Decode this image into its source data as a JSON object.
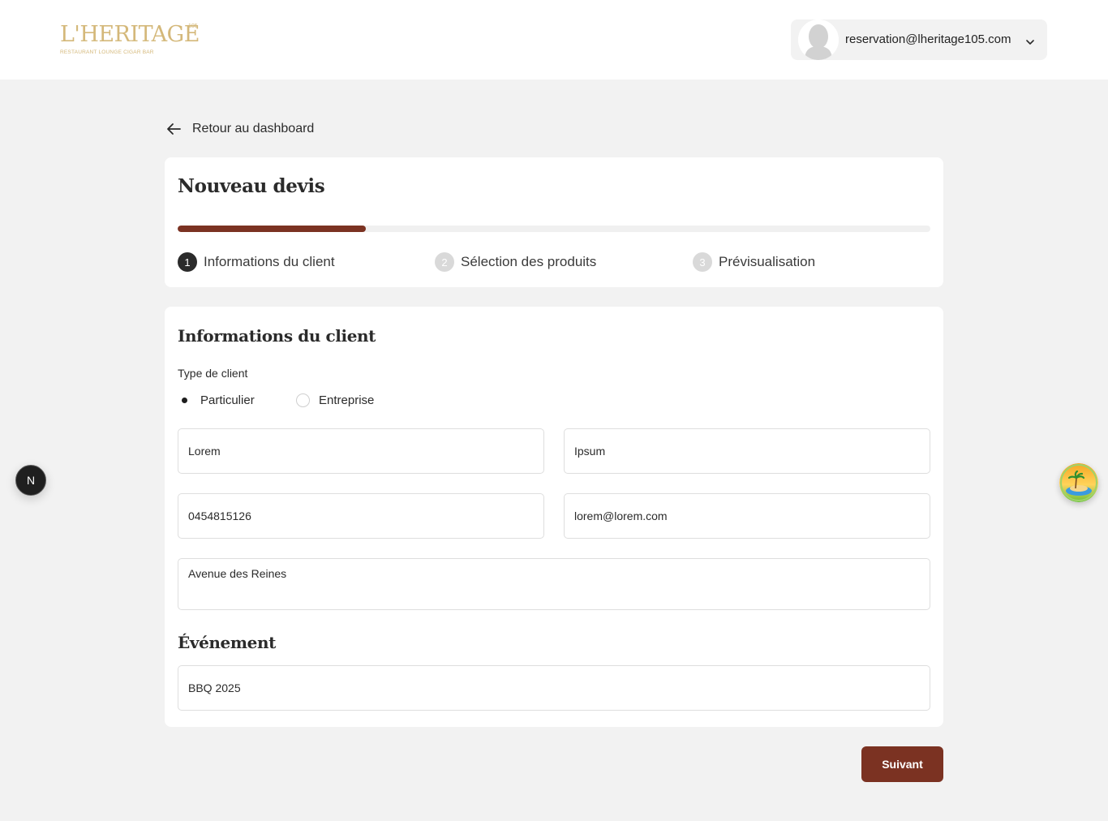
{
  "header": {
    "logo": {
      "main": "L'HERITAGE",
      "sup": "105",
      "tagline": "RESTAURANT LOUNGE CIGAR BAR"
    },
    "user": {
      "email": "reservation@lheritage105.com"
    }
  },
  "nav": {
    "back_label": "Retour au dashboard"
  },
  "wizard": {
    "title": "Nouveau devis",
    "progress": 0.25,
    "steps": [
      {
        "number": "1",
        "label": "Informations du client",
        "active": true
      },
      {
        "number": "2",
        "label": "Sélection des produits",
        "active": false
      },
      {
        "number": "3",
        "label": "Prévisualisation",
        "active": false
      }
    ]
  },
  "form": {
    "section_title": "Informations du client",
    "client_type_label": "Type de client",
    "client_types": [
      {
        "label": "Particulier",
        "checked": true
      },
      {
        "label": "Entreprise",
        "checked": false
      }
    ],
    "fields": {
      "first_name": "Lorem",
      "last_name": "Ipsum",
      "phone": "0454815126",
      "email": "lorem@lorem.com",
      "address": "Avenue des Reines"
    },
    "event_section_title": "Événement",
    "event_name": "BBQ 2025"
  },
  "actions": {
    "next_label": "Suivant"
  },
  "floating": {
    "n_badge": "N"
  },
  "colors": {
    "accent": "#7b3222",
    "gold": "#d4b87a",
    "background": "#f2f2f2"
  }
}
